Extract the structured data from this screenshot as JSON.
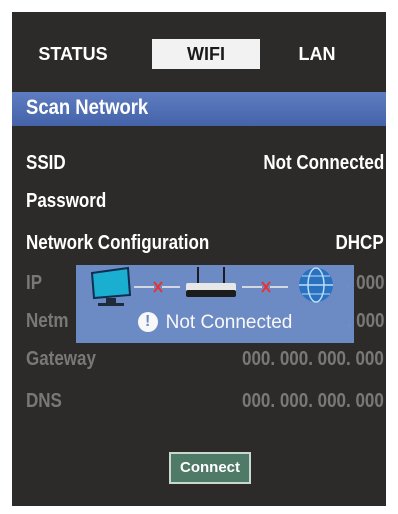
{
  "tabs": [
    {
      "label": "STATUS",
      "active": false
    },
    {
      "label": "WIFI",
      "active": true
    },
    {
      "label": "LAN",
      "active": false
    }
  ],
  "section_title": "Scan Network",
  "fields": {
    "ssid": {
      "label": "SSID",
      "value": "Not Connected"
    },
    "password": {
      "label": "Password",
      "value": ""
    },
    "network_config": {
      "label": "Network Configuration",
      "value": "DHCP"
    },
    "ip": {
      "label": "IP",
      "value": ". 000"
    },
    "netmask": {
      "label": "Netm",
      "value": ". 000"
    },
    "gateway": {
      "label": "Gateway",
      "value": "000. 000. 000. 000"
    },
    "dns": {
      "label": "DNS",
      "value": "000. 000. 000. 000"
    }
  },
  "popup": {
    "message": "Not Connected",
    "icons": [
      "monitor-icon",
      "broken-link-icon",
      "router-icon",
      "broken-link-icon",
      "globe-icon"
    ]
  },
  "connect_button": {
    "label": "Connect"
  },
  "colors": {
    "panel_bg": "#2d2b2a",
    "section_bar": "#4463a9",
    "popup_bg": "#6f8fc9",
    "button_bg": "#4e7a67",
    "dim_text": "#7a7876"
  }
}
